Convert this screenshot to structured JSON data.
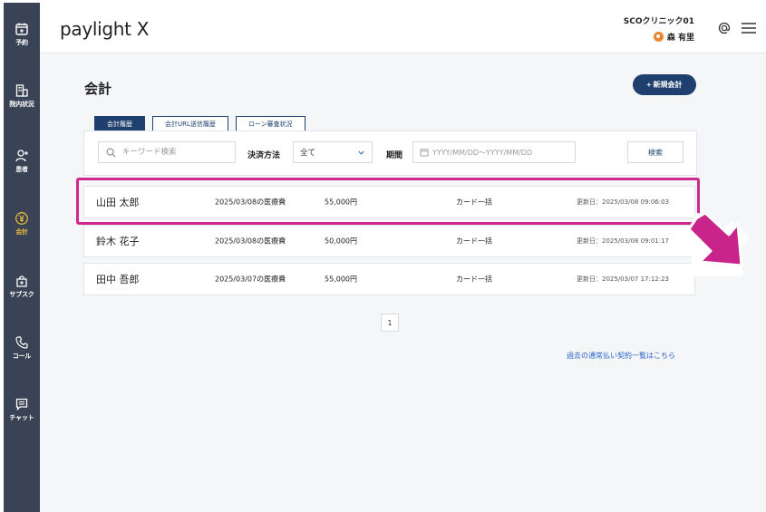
{
  "sidebar": {
    "items": [
      {
        "label": "予約",
        "icon": "calendar-icon"
      },
      {
        "label": "院内状況",
        "icon": "hospital-icon"
      },
      {
        "label": "患者",
        "icon": "patient-icon"
      },
      {
        "label": "会計",
        "icon": "yen-icon",
        "active": true
      },
      {
        "label": "サブスク",
        "icon": "subscription-icon"
      },
      {
        "label": "コール",
        "icon": "phone-icon"
      },
      {
        "label": "チャット",
        "icon": "chat-icon"
      }
    ]
  },
  "header": {
    "logo": "paylight X",
    "clinic": "SCOクリニック01",
    "user": "森 有里",
    "icons": [
      "at-icon",
      "menu-icon"
    ]
  },
  "main": {
    "title": "会計",
    "new_button": "+ 新規会計",
    "tabs": [
      {
        "label": "会計履歴",
        "active": true
      },
      {
        "label": "会計URL送信履歴"
      },
      {
        "label": "ローン審査状況"
      }
    ],
    "filter": {
      "search_placeholder": "キーワード検索",
      "method_label": "決済方法",
      "method_value": "全て",
      "period_label": "期間",
      "period_placeholder": "YYYY/MM/DD〜YYYY/MM/DD",
      "search_button": "検索"
    },
    "rows": [
      {
        "name": "山田 太郎",
        "date": "2025/03/08の医療費",
        "amount": "55,000円",
        "method": "カード一括",
        "updated": "更新日：2025/03/08 09:06:03"
      },
      {
        "name": "鈴木 花子",
        "date": "2025/03/08の医療費",
        "amount": "50,000円",
        "method": "カード一括",
        "updated": "更新日：2025/03/08 09:01:17"
      },
      {
        "name": "田中 吾郎",
        "date": "2025/03/07の医療費",
        "amount": "55,000円",
        "method": "カード一括",
        "updated": "更新日：2025/03/07 17:12:23"
      }
    ],
    "page": "1",
    "past_link": "過去の通常払い契約一覧はこちら"
  },
  "colors": {
    "sidebar": "#3a4356",
    "accent": "#1f3f6e",
    "active_nav": "#e3b93b",
    "highlight": "#d0278d",
    "link": "#2b66c9"
  }
}
